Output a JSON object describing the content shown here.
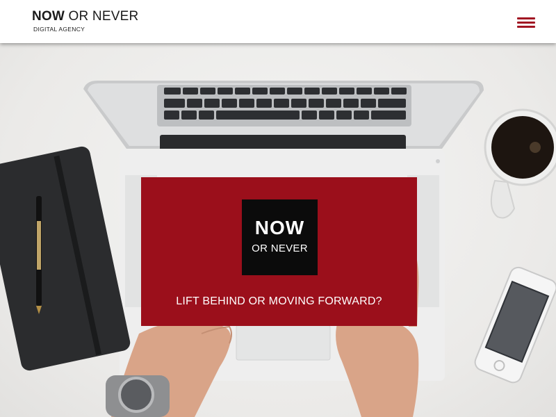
{
  "header": {
    "brand_now": "NOW",
    "brand_rest": " OR NEVER",
    "tagline": "DIGITAL AGENCY",
    "menu_icon": "hamburger-menu-icon",
    "accent_color": "#a11522"
  },
  "hero": {
    "background_image": "desk-with-laptop-notebook-coffee-phone",
    "card": {
      "background_color": "#9b0f1b",
      "logo_line1": "NOW",
      "logo_line2": "OR NEVER",
      "headline": "LIFT BEHIND OR MOVING FORWARD?"
    }
  }
}
